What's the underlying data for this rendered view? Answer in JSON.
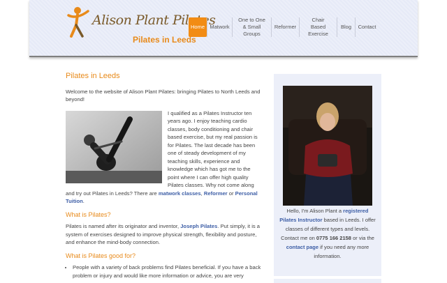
{
  "header": {
    "logo_name": "Alison Plant Pilates",
    "logo_sub": "Pilates in Leeds"
  },
  "nav": {
    "items": [
      {
        "label": "Home",
        "active": true
      },
      {
        "label": "Matwork"
      },
      {
        "label": "One to One & Small Groups"
      },
      {
        "label": "Reformer"
      },
      {
        "label": "Chair Based Exercise"
      },
      {
        "label": "Blog"
      },
      {
        "label": "Contact"
      }
    ]
  },
  "main": {
    "title": "Pilates in Leeds",
    "welcome": "Welcome to the website of Alison Plant Pilates: bringing Pilates to North Leeds and beyond!",
    "intro_pre": "I qualified as a Pilates Instructor ten years ago. I enjoy teaching cardio classes, body conditioning and chair based exercise, but my real passion is for Pilates. The last decade has been one of steady development of my teaching skills, experience and knowledge which has got me to the point where I can offer high quality Pilates classes.  Why not come along and try out Pilates in Leeds? There are ",
    "link_matwork": "matwork classes",
    "intro_sep1": ", ",
    "link_reformer": "Reformer",
    "intro_sep2": " or ",
    "link_personal": "Personal Tuition",
    "intro_end": ".",
    "what_heading": "What is Pilates?",
    "what_pre": "Pilates is named after its originator and inventor, ",
    "link_joseph": "Joseph Pilates",
    "what_post": ". Put simply, it is a system of exercises designed to improve physical strength, flexibility and posture, and enhance the mind-body connection.",
    "good_heading": "What is Pilates good for?",
    "bullet1": "People with a variety of back problems find Pilates beneficial. If you have a back problem or injury and would like more information or advice, you are very"
  },
  "sidebar": {
    "hello_pre": "Hello, I'm Alison Plant a ",
    "link_registered": "registered Pilates Instructor",
    "hello_mid": " based in Leeds. I offer classes of different types and levels. Contact me on ",
    "phone": "0775 166 2158",
    "hello_or": " or via the ",
    "link_contact": "contact page",
    "hello_end": " if you need any more information."
  },
  "colors": {
    "accent": "#f28c14",
    "link": "#3d5ea6",
    "header_bg": "#eceff9"
  }
}
